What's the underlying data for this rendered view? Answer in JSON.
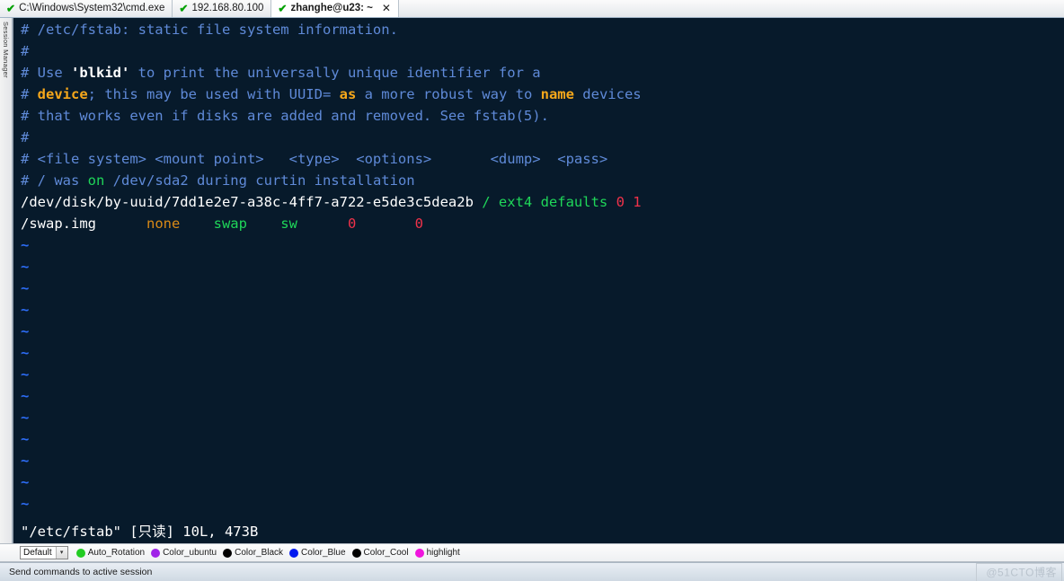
{
  "window": {
    "sidebar_label": "Session Manager"
  },
  "tabs": [
    {
      "label": "C:\\Windows\\System32\\cmd.exe",
      "status_icon": "check-icon",
      "active": false,
      "closable": false
    },
    {
      "label": "192.168.80.100",
      "status_icon": "check-icon",
      "active": false,
      "closable": false
    },
    {
      "label": "zhanghe@u23: ~",
      "status_icon": "check-icon",
      "active": true,
      "closable": true,
      "close_label": "✕"
    }
  ],
  "terminal": {
    "background": "#071a2b",
    "foreground": "#c9d6e4",
    "lines": [
      [
        {
          "t": "# /etc/fstab: static file system information.",
          "c": "c-comment"
        }
      ],
      [
        {
          "t": "#",
          "c": "c-comment"
        }
      ],
      [
        {
          "t": "# Use ",
          "c": "c-comment"
        },
        {
          "t": "'blkid'",
          "c": "c-string"
        },
        {
          "t": " to print the universally unique identifier for a",
          "c": "c-comment"
        }
      ],
      [
        {
          "t": "# ",
          "c": "c-comment"
        },
        {
          "t": "device",
          "c": "c-keyword"
        },
        {
          "t": "; this may be used with UUID= ",
          "c": "c-comment"
        },
        {
          "t": "as",
          "c": "c-keyword"
        },
        {
          "t": " a more robust way to ",
          "c": "c-comment"
        },
        {
          "t": "name",
          "c": "c-keyword"
        },
        {
          "t": " devices",
          "c": "c-comment"
        }
      ],
      [
        {
          "t": "# that works even if disks are added and removed. See fstab(5).",
          "c": "c-comment"
        }
      ],
      [
        {
          "t": "#",
          "c": "c-comment"
        }
      ],
      [
        {
          "t": "# <file system> <mount point>   <type>  <options>       <dump>  <pass>",
          "c": "c-comment"
        }
      ],
      [
        {
          "t": "# / was ",
          "c": "c-comment"
        },
        {
          "t": "on",
          "c": "c-green"
        },
        {
          "t": " /dev/sda2 during curtin installation",
          "c": "c-comment"
        }
      ],
      [
        {
          "t": "/dev/disk/by-uuid/7dd1e2e7-a38c-4ff7-a722-e5de3c5dea2b ",
          "c": "c-white"
        },
        {
          "t": "/ ext4 defaults ",
          "c": "c-green"
        },
        {
          "t": "0 1",
          "c": "c-red"
        }
      ],
      [
        {
          "t": "/swap.img      ",
          "c": "c-white"
        },
        {
          "t": "none",
          "c": "c-orange"
        },
        {
          "t": "    ",
          "c": "c-white"
        },
        {
          "t": "swap",
          "c": "c-green"
        },
        {
          "t": "    ",
          "c": "c-white"
        },
        {
          "t": "sw",
          "c": "c-green"
        },
        {
          "t": "      ",
          "c": "c-white"
        },
        {
          "t": "0",
          "c": "c-red"
        },
        {
          "t": "       ",
          "c": "c-white"
        },
        {
          "t": "0",
          "c": "c-red"
        }
      ],
      [
        {
          "t": "~",
          "c": "c-tilde"
        }
      ],
      [
        {
          "t": "~",
          "c": "c-tilde"
        }
      ],
      [
        {
          "t": "~",
          "c": "c-tilde"
        }
      ],
      [
        {
          "t": "~",
          "c": "c-tilde"
        }
      ],
      [
        {
          "t": "~",
          "c": "c-tilde"
        }
      ],
      [
        {
          "t": "~",
          "c": "c-tilde"
        }
      ],
      [
        {
          "t": "~",
          "c": "c-tilde"
        }
      ],
      [
        {
          "t": "~",
          "c": "c-tilde"
        }
      ],
      [
        {
          "t": "~",
          "c": "c-tilde"
        }
      ],
      [
        {
          "t": "~",
          "c": "c-tilde"
        }
      ],
      [
        {
          "t": "~",
          "c": "c-tilde"
        }
      ],
      [
        {
          "t": "~",
          "c": "c-tilde"
        }
      ],
      [
        {
          "t": "~",
          "c": "c-tilde"
        }
      ]
    ],
    "status_line": "\"/etc/fstab\" [只读] 10L, 473B"
  },
  "colorbar": {
    "select_value": "Default",
    "select_arrow": "▾",
    "swatches": [
      {
        "label": "Auto_Rotation",
        "color": "#22cc22"
      },
      {
        "label": "Color_ubuntu",
        "color": "#a024e8"
      },
      {
        "label": "Color_Black",
        "color": "#000000"
      },
      {
        "label": "Color_Blue",
        "color": "#0018f0"
      },
      {
        "label": "Color_Cool",
        "color": "#000000"
      },
      {
        "label": "highlight",
        "color": "#f015dd"
      }
    ]
  },
  "statusbar": {
    "text": "Send commands to active session",
    "watermark": "@51CTO博客"
  }
}
